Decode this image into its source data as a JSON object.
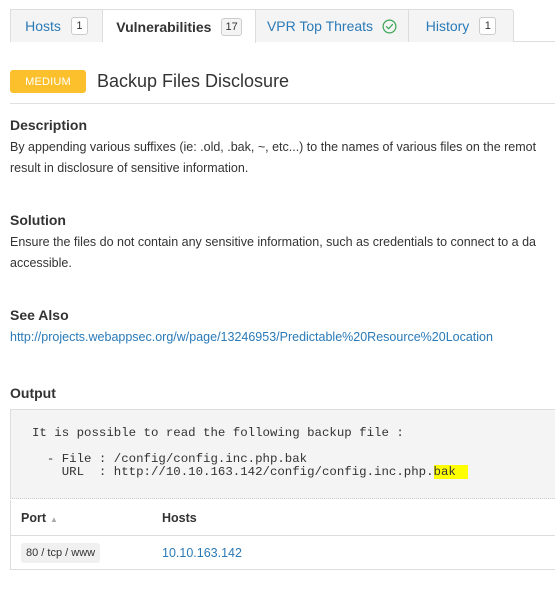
{
  "tabs": [
    {
      "label": "Hosts",
      "count": "1",
      "active": false
    },
    {
      "label": "Vulnerabilities",
      "count": "17",
      "active": true
    },
    {
      "label": "VPR Top Threats",
      "icon": "check-circle-icon",
      "active": false
    },
    {
      "label": "History",
      "count": "1",
      "active": false
    }
  ],
  "vulnerability": {
    "severity": "MEDIUM",
    "title": "Backup Files Disclosure"
  },
  "description": {
    "heading": "Description",
    "line1": "By appending various suffixes (ie: .old, .bak, ~, etc...) to the names of various files on the remot",
    "line2": "result in disclosure of sensitive information."
  },
  "solution": {
    "heading": "Solution",
    "line1": "Ensure the files do not contain any sensitive information, such as credentials to connect to a da",
    "line2": "accessible."
  },
  "see_also": {
    "heading": "See Also",
    "link": "http://projects.webappsec.org/w/page/13246953/Predictable%20Resource%20Location"
  },
  "output": {
    "heading": "Output",
    "line1": "It is possible to read the following backup file :",
    "line2": "  - File : /config/config.inc.php.bak",
    "line3_prefix": "    URL  : http://10.10.163.142/config/config.inc.php.",
    "line3_highlight": "bak"
  },
  "table": {
    "columns": [
      "Port",
      "Hosts"
    ],
    "sort_icon": "sort-asc-icon",
    "rows": [
      {
        "port": "80 / tcp / www",
        "host": "10.10.163.142"
      }
    ]
  },
  "colors": {
    "accent": "#2a7ab8",
    "severity_medium": "#fcc02d",
    "highlight": "#ffff00",
    "success": "#3aa655"
  }
}
